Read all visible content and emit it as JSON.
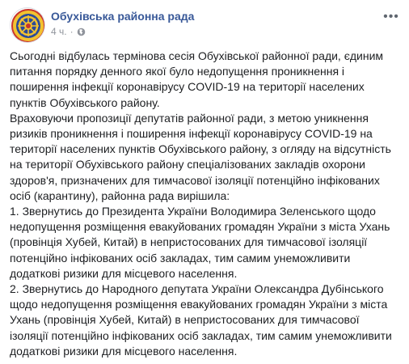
{
  "post": {
    "page_name": "Обухівська районна рада",
    "timestamp": "4 ч.",
    "separator": "·",
    "privacy_icon": "globe-icon",
    "menu_icon": "more-options-icon",
    "brand_color": "#385898",
    "lines": [
      "Сьогодні відбулась термінова сесія Обухівської районної ради, єдиним",
      "питання порядку денного якої було недопущення проникнення і",
      "поширення інфекції коронавірусу COVID-19 на території населених",
      "пунктів Обухівського району.",
      "Враховуючи пропозиції депутатів районної ради, з метою уникнення",
      "ризиків проникнення і поширення інфекції коронавірусу COVID-19 на",
      "території населених пунктів Обухівського району, з огляду на відсутність",
      "на території Обухівського району спеціалізованих закладів охорони",
      "здоров'я, призначених для тимчасової ізоляції потенційно інфікованих",
      "осіб (карантину), районна рада вирішила:",
      "1. Звернутись до Президента України Володимира Зеленського щодо",
      "недопущення розміщення евакуйованих громадян України з міста Ухань",
      "(провінція Хубей, Китай) в непристосованих для тимчасової ізоляції",
      "потенційно інфікованих осіб закладах, тим самим унеможливити",
      "додаткові ризики для місцевого населення.",
      "2. Звернутись до Народного депутата України Олександра Дубінського",
      "щодо недопущення розміщення евакуйованих громадян України з міста",
      "Ухань (провінція Хубей, Китай) в непристосованих для тимчасової",
      "ізоляції потенційно інфікованих осіб закладах, тим самим унеможливити",
      "додаткові ризики для місцевого населення."
    ]
  }
}
